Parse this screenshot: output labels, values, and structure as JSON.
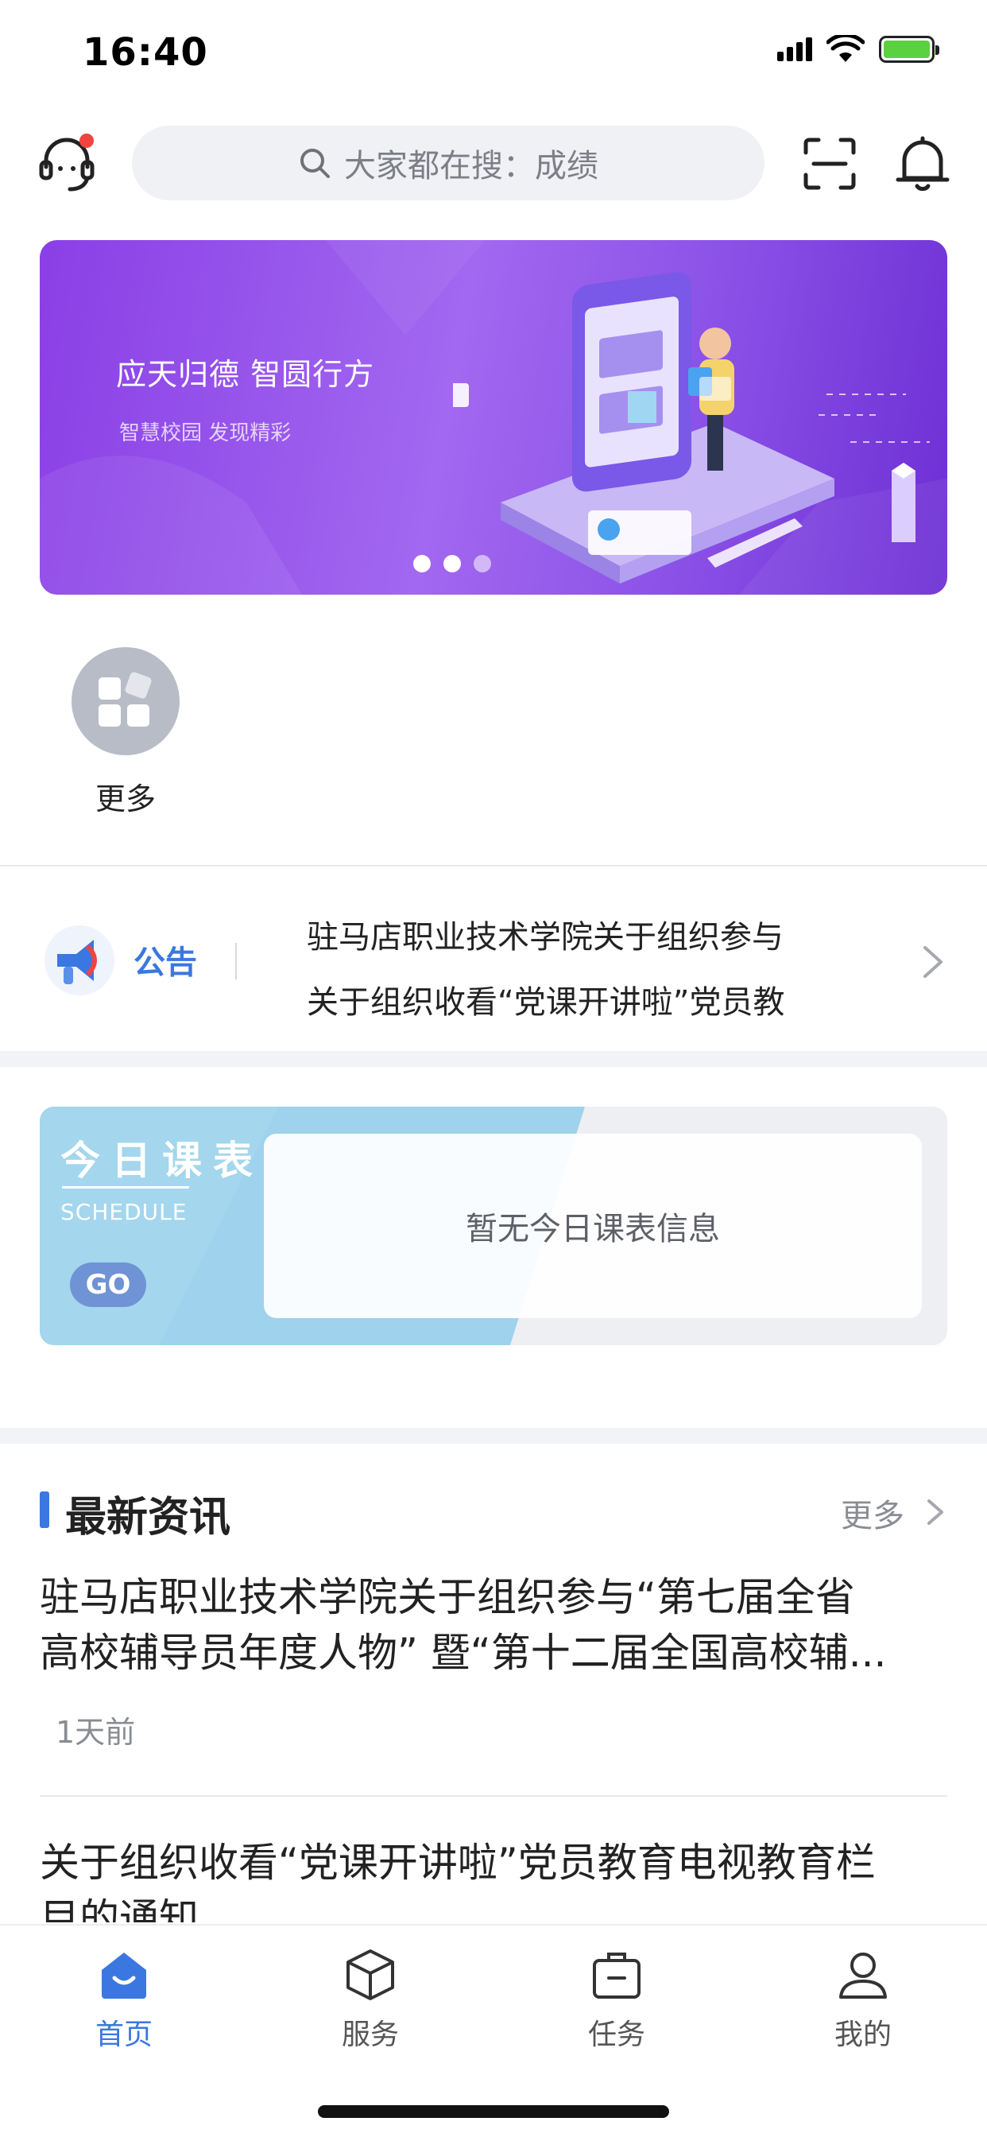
{
  "status_bar": {
    "time": "16:40"
  },
  "header": {
    "search_placeholder": "大家都在搜：成绩"
  },
  "banner": {
    "title": "应天归德 智圆行方",
    "subtitle": "智慧校园 发现精彩"
  },
  "quick_entries": [
    {
      "label": "更多",
      "icon": "grid-apps-icon"
    }
  ],
  "notice": {
    "tag": "公告",
    "items": [
      "驻马店职业技术学院关于组织参与",
      "关于组织收看“党课开讲啦”党员教"
    ]
  },
  "schedule": {
    "title": "今日课表",
    "title_en": "SCHEDULE",
    "go_label": "GO",
    "empty_text": "暂无今日课表信息"
  },
  "news": {
    "title": "最新资讯",
    "more_label": "更多",
    "items": [
      {
        "line1": "驻马店职业技术学院关于组织参与“第七届全省",
        "line2": "高校辅导员年度人物” 暨“第十二届全国高校辅...",
        "time": "1天前"
      },
      {
        "line1": "关于组织收看“党课开讲啦”党员教育电视教育栏",
        "line2": "目的通知"
      }
    ]
  },
  "tabbar": {
    "items": [
      {
        "label": "首页",
        "icon": "home-icon",
        "active": true
      },
      {
        "label": "服务",
        "icon": "cube-icon",
        "active": false
      },
      {
        "label": "任务",
        "icon": "briefcase-icon",
        "active": false
      },
      {
        "label": "我的",
        "icon": "user-icon",
        "active": false
      }
    ]
  },
  "colors": {
    "accent": "#3a77e0",
    "banner": "#8a3fe6",
    "notification_dot": "#f0443f"
  }
}
